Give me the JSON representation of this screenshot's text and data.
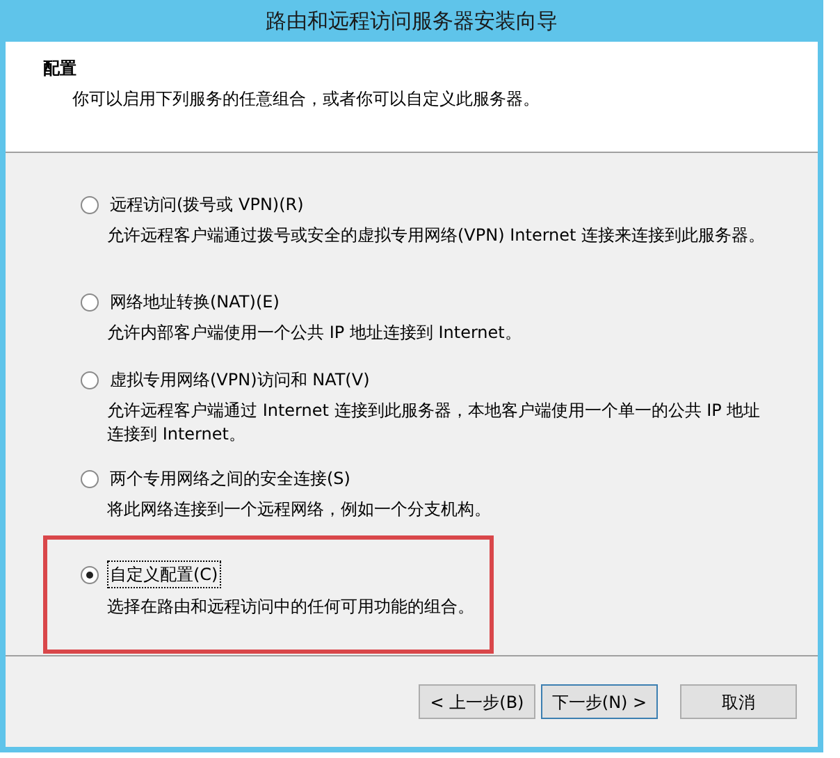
{
  "window": {
    "title": "路由和远程访问服务器安装向导"
  },
  "header": {
    "title": "配置",
    "subtitle": "你可以启用下列服务的任意组合，或者你可以自定义此服务器。"
  },
  "options": [
    {
      "label": "远程访问(拨号或 VPN)(R)",
      "description": "允许远程客户端通过拨号或安全的虚拟专用网络(VPN) Internet 连接来连接到此服务器。",
      "selected": false,
      "highlighted": false
    },
    {
      "label": "网络地址转换(NAT)(E)",
      "description": "允许内部客户端使用一个公共 IP 地址连接到 Internet。",
      "selected": false,
      "highlighted": false
    },
    {
      "label": "虚拟专用网络(VPN)访问和 NAT(V)",
      "description": "允许远程客户端通过 Internet 连接到此服务器，本地客户端使用一个单一的公共 IP 地址连接到 Internet。",
      "selected": false,
      "highlighted": false
    },
    {
      "label": "两个专用网络之间的安全连接(S)",
      "description": "将此网络连接到一个远程网络，例如一个分支机构。",
      "selected": false,
      "highlighted": false
    },
    {
      "label": "自定义配置(C)",
      "description": "选择在路由和远程访问中的任何可用功能的组合。",
      "selected": true,
      "highlighted": true
    }
  ],
  "buttons": [
    {
      "label": "< 上一步(B)",
      "default": false
    },
    {
      "label": "下一步(N) >",
      "default": true
    },
    {
      "label": "取消",
      "default": false
    }
  ]
}
